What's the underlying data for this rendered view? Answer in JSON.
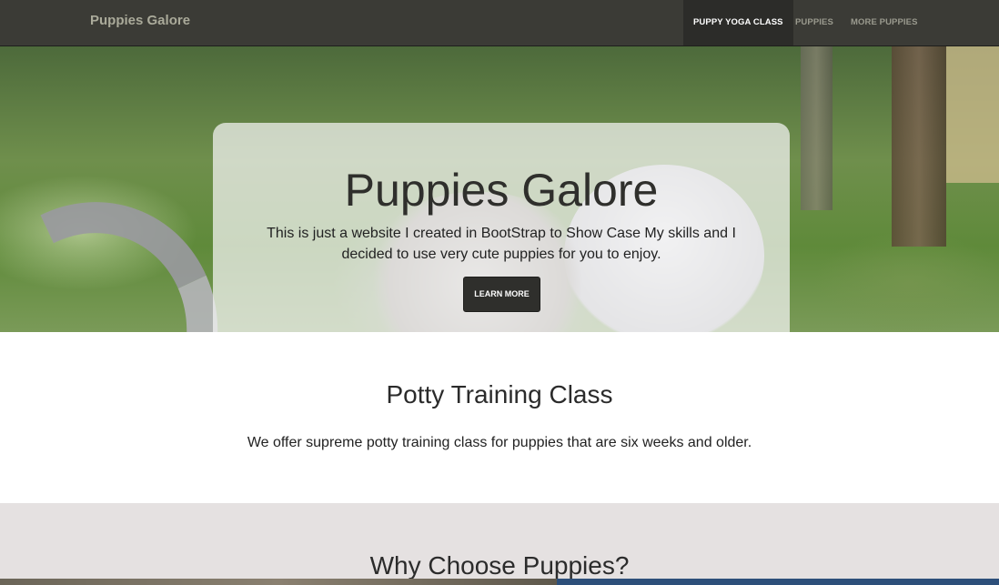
{
  "navbar": {
    "brand": "Puppies Galore",
    "items": [
      {
        "label": "PUPPY YOGA CLASS",
        "active": true
      },
      {
        "label": "PUPPIES",
        "active": false
      },
      {
        "label": "MORE PUPPIES",
        "active": false
      }
    ]
  },
  "hero": {
    "title": "Puppies Galore",
    "text": "This is just a website I created in BootStrap to Show Case My skills and I decided to use very cute puppies for you to enjoy.",
    "button_label": "LEARN MORE"
  },
  "sections": [
    {
      "title": "Potty Training Class",
      "text": "We offer supreme potty training class for puppies that are six weeks and older."
    },
    {
      "title": "Why Choose Puppies?"
    }
  ],
  "colors": {
    "navbar_bg": "#3b3b36",
    "active_nav_bg": "#2c2c29",
    "button_bg": "#2f2f2c",
    "gray_section_bg": "#e5e1e1"
  }
}
